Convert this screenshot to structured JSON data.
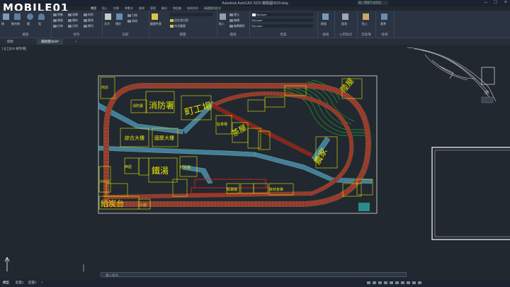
{
  "window": {
    "title": "Autodesk AutoCAD 2020   鐵路圖0629.dwg",
    "search_placeholder": "鍵入關鍵字或詞組",
    "controls": [
      "–",
      "□",
      "×"
    ]
  },
  "watermark": "MOBILE01",
  "ribbon": {
    "tabs": [
      "常用",
      "插入",
      "註解",
      "參數式",
      "檢視",
      "管理",
      "輸出",
      "增益集",
      "協同合作",
      "精選應用程式"
    ],
    "groups": [
      {
        "label": "繪製",
        "items": [
          "線",
          "聚合線",
          "圓",
          "弧"
        ]
      },
      {
        "label": "修改",
        "items": [
          "移動",
          "旋轉",
          "修剪",
          "複製",
          "鏡射",
          "圓角",
          "拉伸",
          "比例",
          "陣列"
        ]
      },
      {
        "label": "註解",
        "items": [
          "文字",
          "標註",
          "引線",
          "表格"
        ]
      },
      {
        "label": "圖層",
        "items": [
          "圖層性質",
          "設定為目前",
          "符合圖層"
        ]
      },
      {
        "label": "圖塊",
        "items": [
          "插入",
          "建立",
          "編輯",
          "編輯屬性"
        ]
      },
      {
        "label": "性質",
        "items": [
          "ByLayer",
          "ByLayer",
          "ByLayer",
          "符合性質"
        ]
      },
      {
        "label": "群組",
        "items": [
          "群組"
        ]
      },
      {
        "label": "公用程式",
        "items": [
          "量測"
        ]
      },
      {
        "label": "剪貼簿",
        "items": [
          "貼上"
        ]
      },
      {
        "label": "檢視",
        "items": [
          "基準"
        ]
      }
    ]
  },
  "doc_tabs": [
    "開始",
    "鐵路圖0629*",
    "+"
  ],
  "viewport_label": "[-][上][2D 線架構]",
  "drawing": {
    "labels": [
      "消防署",
      "町工場",
      "茶屋",
      "鐵湯",
      "農家",
      "給炭台",
      "綜合大樓",
      "國聚大樓",
      "商店",
      "資材倉庫",
      "消防廳",
      "陸屋",
      "貯木場",
      "販賣機",
      "駐車場",
      "西屋",
      "小屋"
    ]
  },
  "compass": {
    "south": "南"
  },
  "command_placeholder": "鍵入指令",
  "status": {
    "tabs": [
      "模型",
      "配置1",
      "配置2",
      "+"
    ]
  },
  "colors": {
    "background": "#212830",
    "ribbon": "#2b3442",
    "track": "#9a1c1c",
    "buildings": "#e6e600",
    "river": "#4a8fa8",
    "hills": "#1fa332",
    "paper": "#ffffff"
  }
}
